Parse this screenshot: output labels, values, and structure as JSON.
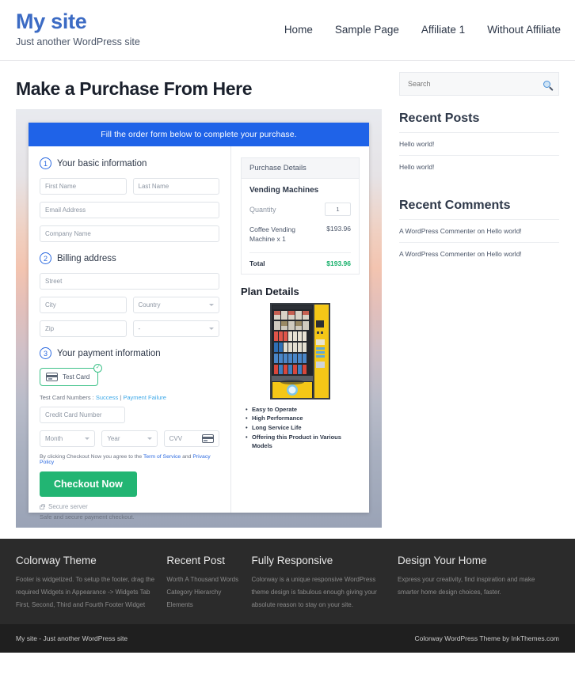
{
  "header": {
    "site_title": "My site",
    "tagline": "Just another WordPress site",
    "nav": [
      {
        "label": "Home"
      },
      {
        "label": "Sample Page"
      },
      {
        "label": "Affiliate 1"
      },
      {
        "label": "Without Affiliate"
      }
    ]
  },
  "main": {
    "page_title": "Make a Purchase From Here",
    "banner": "Fill the order form below to complete your purchase.",
    "steps": {
      "one_num": "1",
      "one_label": "Your basic information",
      "two_num": "2",
      "two_label": "Billing address",
      "three_num": "3",
      "three_label": "Your payment information"
    },
    "fields": {
      "first_name": "First Name",
      "last_name": "Last Name",
      "email": "Email Address",
      "company": "Company Name",
      "street": "Street",
      "city": "City",
      "country": "Country",
      "zip": "Zip",
      "state": "-",
      "credit_card": "Credit Card Number",
      "month": "Month",
      "year": "Year",
      "cvv": "CVV"
    },
    "payment": {
      "test_card_label": "Test Card",
      "check_glyph": "✓",
      "test_numbers_prefix": "Test Card Numbers : ",
      "success_link": "Success",
      "separator": " | ",
      "failure_link": "Payment Failure",
      "agree_prefix": "By clicking Checkout Now you agree to the ",
      "terms_link": "Term of Service",
      "agree_mid": " and ",
      "privacy_link": "Privacy Policy",
      "checkout_label": "Checkout Now",
      "secure_server": "Secure server",
      "safe_note": "Safe and secure payment checkout."
    },
    "purchase_details": {
      "heading": "Purchase Details",
      "product": "Vending Machines",
      "quantity_label": "Quantity",
      "quantity_value": "1",
      "item_name": "Coffee Vending Machine x 1",
      "item_price": "$193.96",
      "total_label": "Total",
      "total_value": "$193.96"
    },
    "plan": {
      "title": "Plan Details",
      "features": [
        "Easy to Operate",
        "High Performance",
        "Long Service Life",
        "Offering this Product in Various Models"
      ]
    }
  },
  "sidebar": {
    "search_placeholder": "Search",
    "recent_posts_title": "Recent Posts",
    "recent_posts": [
      {
        "label": "Hello world!"
      },
      {
        "label": "Hello world!"
      }
    ],
    "recent_comments_title": "Recent Comments",
    "recent_comments": [
      {
        "label": "A WordPress Commenter on Hello world!"
      },
      {
        "label": "A WordPress Commenter on Hello world!"
      }
    ]
  },
  "footer": {
    "columns": [
      {
        "title": "Colorway Theme",
        "text": "Footer is widgetized. To setup the footer, drag the required Widgets in Appearance -> Widgets Tab First, Second, Third and Fourth Footer Widget"
      },
      {
        "title": "Recent Post",
        "items": [
          {
            "label": "Worth A Thousand Words"
          },
          {
            "label": "Category Hierarchy"
          },
          {
            "label": "Elements"
          }
        ]
      },
      {
        "title": "Fully Responsive",
        "text": "Colorway is a unique responsive WordPress theme design is fabulous enough giving your absolute reason to stay on your site."
      },
      {
        "title": "Design Your Home",
        "text": "Express your creativity, find inspiration and make smarter home design choices, faster."
      }
    ],
    "bottom_left": "My site - Just another WordPress site",
    "bottom_right": "Colorway WordPress Theme by InkThemes.com"
  }
}
